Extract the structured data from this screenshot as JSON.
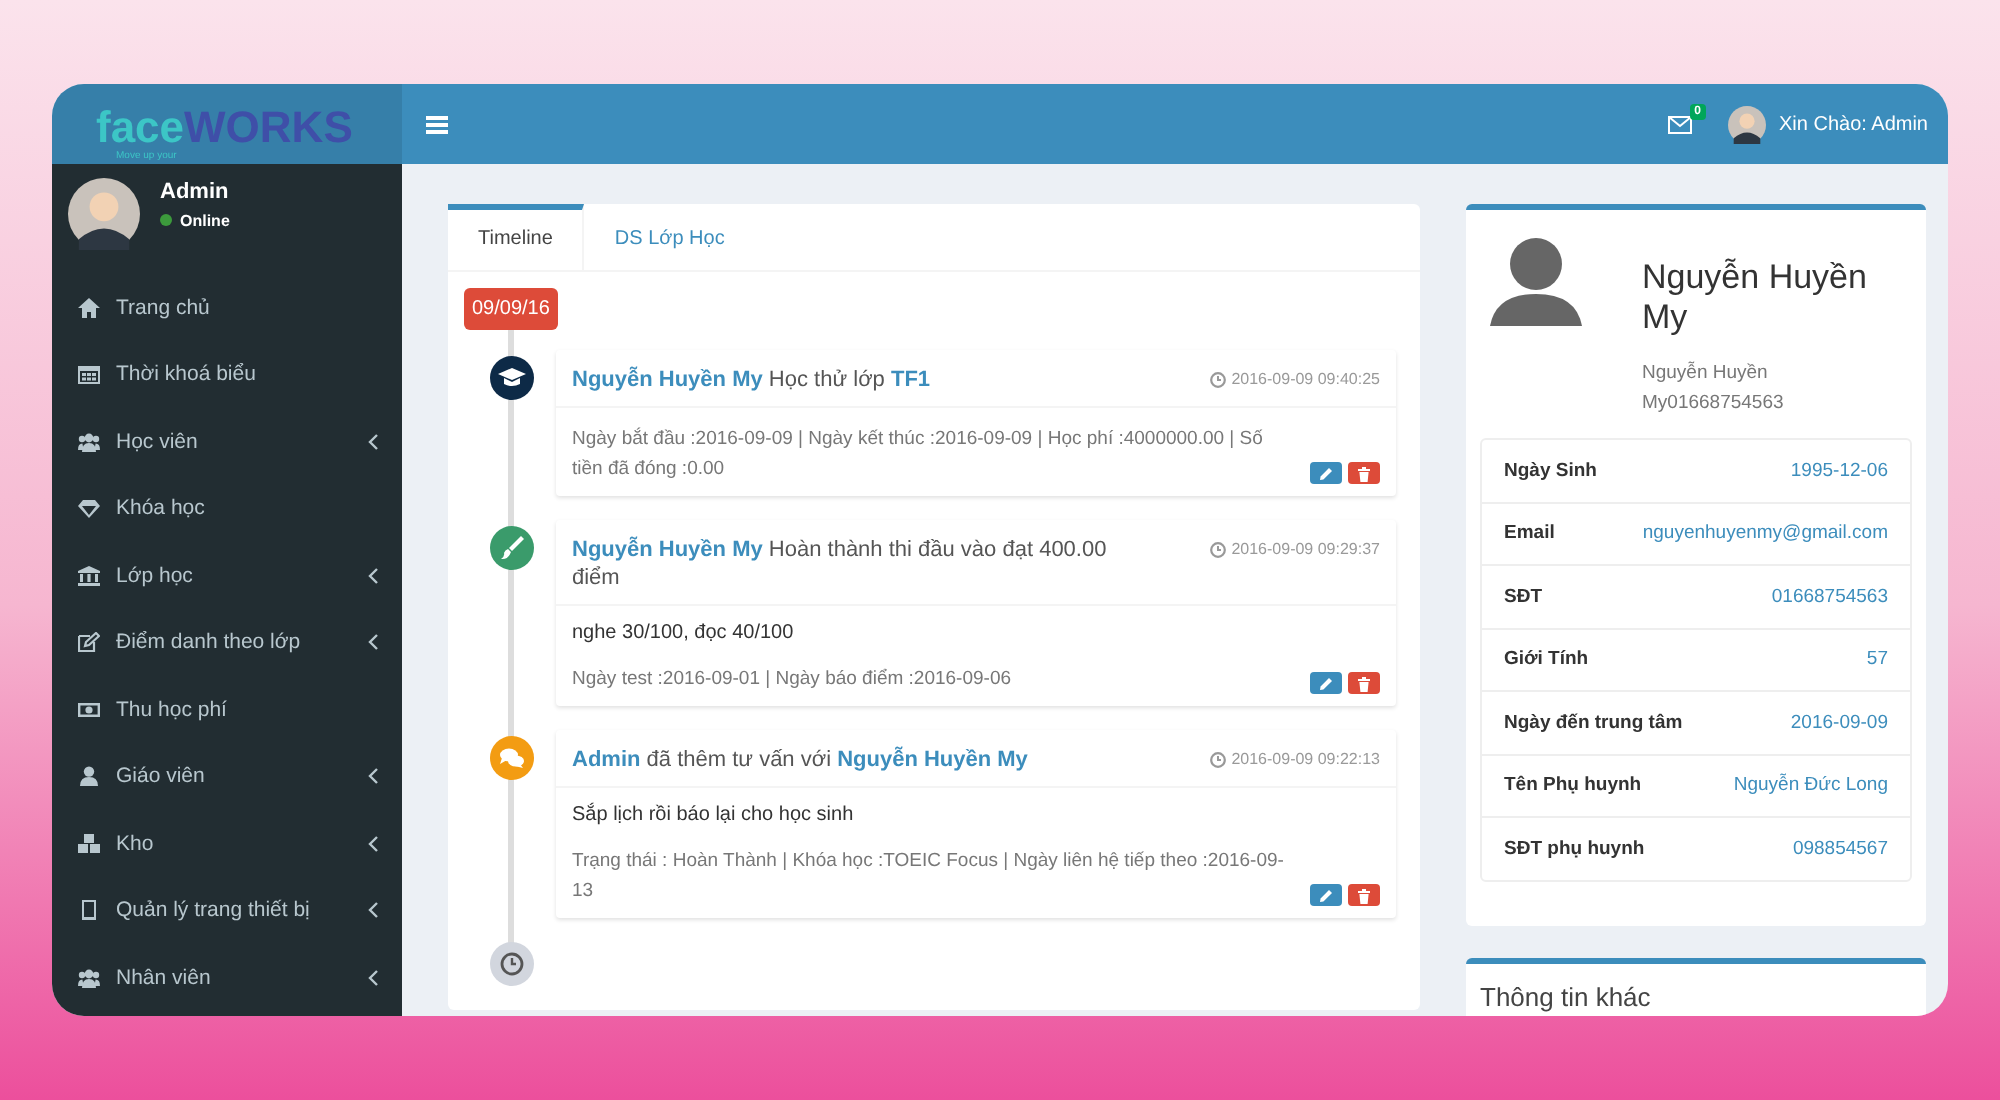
{
  "logo": {
    "part_1": "face",
    "part_2": "WORKS",
    "tagline": "Move up your"
  },
  "header": {
    "mail_count": "0",
    "greeting": "Xin Chào: Admin"
  },
  "sidebar": {
    "user": {
      "name": "Admin",
      "status": "Online",
      "online": true
    },
    "items": [
      {
        "kind": "home",
        "label": "Trang chủ",
        "expandable": false
      },
      {
        "kind": "calendar",
        "label": "Thời khoá biểu",
        "expandable": false
      },
      {
        "kind": "users",
        "label": "Học viên",
        "expandable": true
      },
      {
        "kind": "diamond",
        "label": "Khóa học",
        "expandable": false
      },
      {
        "kind": "bank",
        "label": "Lớp học",
        "expandable": true
      },
      {
        "kind": "edit",
        "label": "Điểm danh theo lớp",
        "expandable": true
      },
      {
        "kind": "money",
        "label": "Thu học phí",
        "expandable": false
      },
      {
        "kind": "user",
        "label": "Giáo viên",
        "expandable": true
      },
      {
        "kind": "cubes",
        "label": "Kho",
        "expandable": true
      },
      {
        "kind": "tablet",
        "label": "Quản lý trang thiết bị",
        "expandable": true
      },
      {
        "kind": "users",
        "label": "Nhân viên",
        "expandable": true
      }
    ]
  },
  "tabs": [
    {
      "label": "Timeline",
      "selected": true
    },
    {
      "label": "DS Lớp Học",
      "selected": false
    }
  ],
  "timeline": {
    "date": "09/09/16",
    "items": [
      {
        "kind": "course",
        "title": "**Nguyễn Huyền My** Học thử lớp **TF1**",
        "time": "2016-09-09 09:40:25",
        "meta": "Ngày bắt đầu :2016-09-09 | Ngày kết thúc :2016-09-09 | Học phí :4000000.00 | Số tiền đã đóng :0.00"
      },
      {
        "kind": "score",
        "title": "**Nguyễn Huyền My** Hoàn thành thi đầu vào đạt 400.00 điểm",
        "time": "2016-09-09 09:29:37",
        "note": "nghe 30/100, đọc 40/100",
        "meta": "Ngày test :2016-09-01 | Ngày báo điểm :2016-09-06"
      },
      {
        "kind": "consult",
        "title": "**Admin** đã thêm tư vấn với **Nguyễn Huyền My**",
        "time": "2016-09-09 09:22:13",
        "note": "Sắp lịch rồi báo lại cho học sinh",
        "meta": "Trạng thái : Hoàn Thành | Khóa học :TOEIC Focus | Ngày liên hệ tiếp theo :2016-09-13"
      }
    ]
  },
  "profile": {
    "name": "Nguyễn Huyền My",
    "subtitle": "Nguyễn Huyền My01668754563",
    "fields": [
      {
        "label": "Ngày Sinh",
        "value": "1995-12-06"
      },
      {
        "label": "Email",
        "value": "nguyenhuyenmy@gmail.com"
      },
      {
        "label": "SĐT",
        "value": "01668754563"
      },
      {
        "label": "Giới Tính",
        "value": "57"
      },
      {
        "label": "Ngày đến trung tâm",
        "value": "2016-09-09"
      },
      {
        "label": "Tên Phụ huynh",
        "value": "Nguyễn Đức Long"
      },
      {
        "label": "SĐT phụ huynh",
        "value": "098854567"
      }
    ]
  },
  "other_info": {
    "title": "Thông tin khác"
  }
}
